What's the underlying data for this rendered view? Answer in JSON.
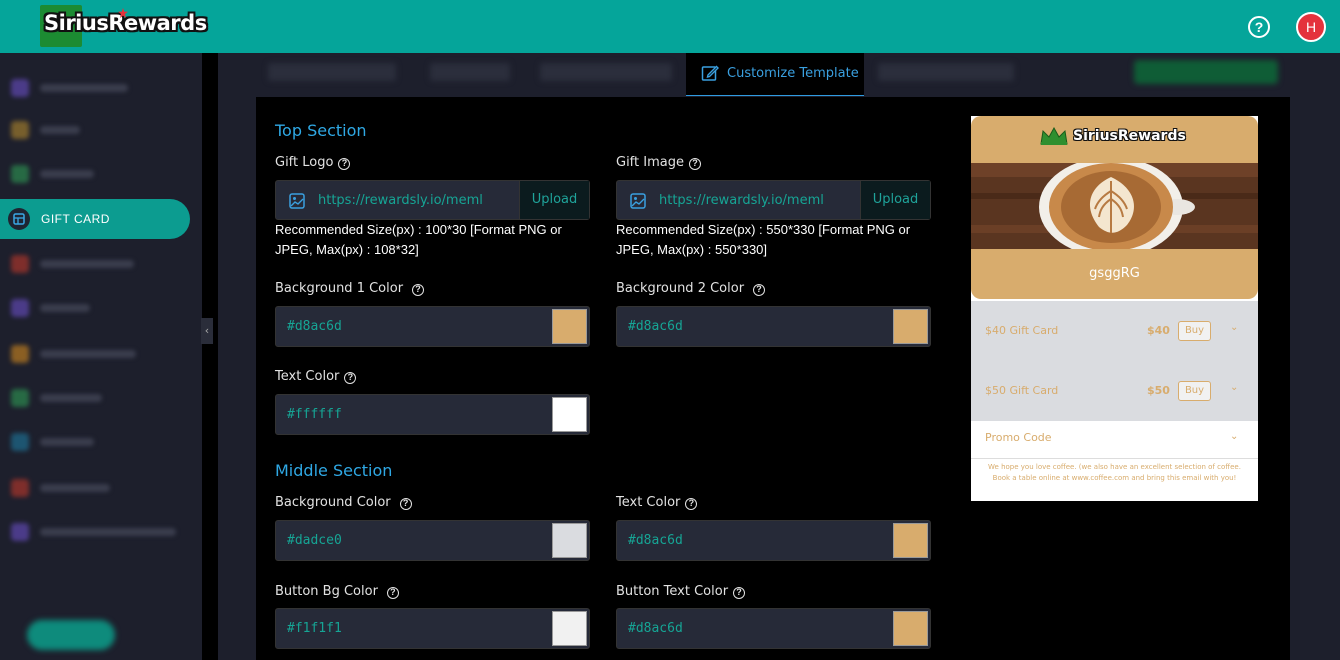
{
  "header": {
    "logo_text": "SiriusRewards",
    "help_icon": "question-circle-icon",
    "avatar_initial": "H",
    "colors": {
      "bar": "#05a59a",
      "avatar": "#e4323c"
    }
  },
  "sidebar": {
    "active_item": {
      "label": "GIFT CARD",
      "icon": "gift-card-icon"
    },
    "blurred_item_count_note": "other items are blurred and unreadable",
    "colors": {
      "active": "#0c9c90",
      "background": "#1d1f2c"
    }
  },
  "tabs": {
    "active_label": "Customize Template",
    "active_icon": "edit-icon"
  },
  "top_section": {
    "title": "Top Section",
    "gift_logo": {
      "label": "Gift Logo",
      "url": "https://rewardsly.io/meml",
      "upload_label": "Upload",
      "hint": "Recommended Size(px) : 100*30 [Format PNG or JPEG, Max(px) : 108*32]"
    },
    "gift_image": {
      "label": "Gift Image",
      "url": "https://rewardsly.io/meml",
      "upload_label": "Upload",
      "hint": "Recommended Size(px) : 550*330 [Format PNG or JPEG, Max(px) : 550*330]"
    },
    "bg1": {
      "label": "Background 1 Color",
      "value": "#d8ac6d"
    },
    "bg2": {
      "label": "Background 2 Color",
      "value": "#d8ac6d"
    },
    "text_color": {
      "label": "Text Color",
      "value": "#ffffff"
    }
  },
  "middle_section": {
    "title": "Middle Section",
    "bg": {
      "label": "Background Color",
      "value": "#dadce0"
    },
    "text_color": {
      "label": "Text Color",
      "value": "#d8ac6d"
    },
    "button_bg": {
      "label": "Button Bg Color",
      "value": "#f1f1f1"
    },
    "button_text": {
      "label": "Button Text Color",
      "value": "#d8ac6d"
    }
  },
  "preview": {
    "logo_text": "SiriusRewards",
    "card_name": "gsggRG",
    "items": [
      {
        "label": "$40 Gift Card",
        "price": "$40",
        "button": "Buy"
      },
      {
        "label": "$50 Gift Card",
        "price": "$50",
        "button": "Buy"
      }
    ],
    "promo_label": "Promo Code",
    "footer_text": "We hope you love coffee. (we also have an excellent selection of coffee. Book a table online at www.coffee.com and bring this email with you!"
  }
}
